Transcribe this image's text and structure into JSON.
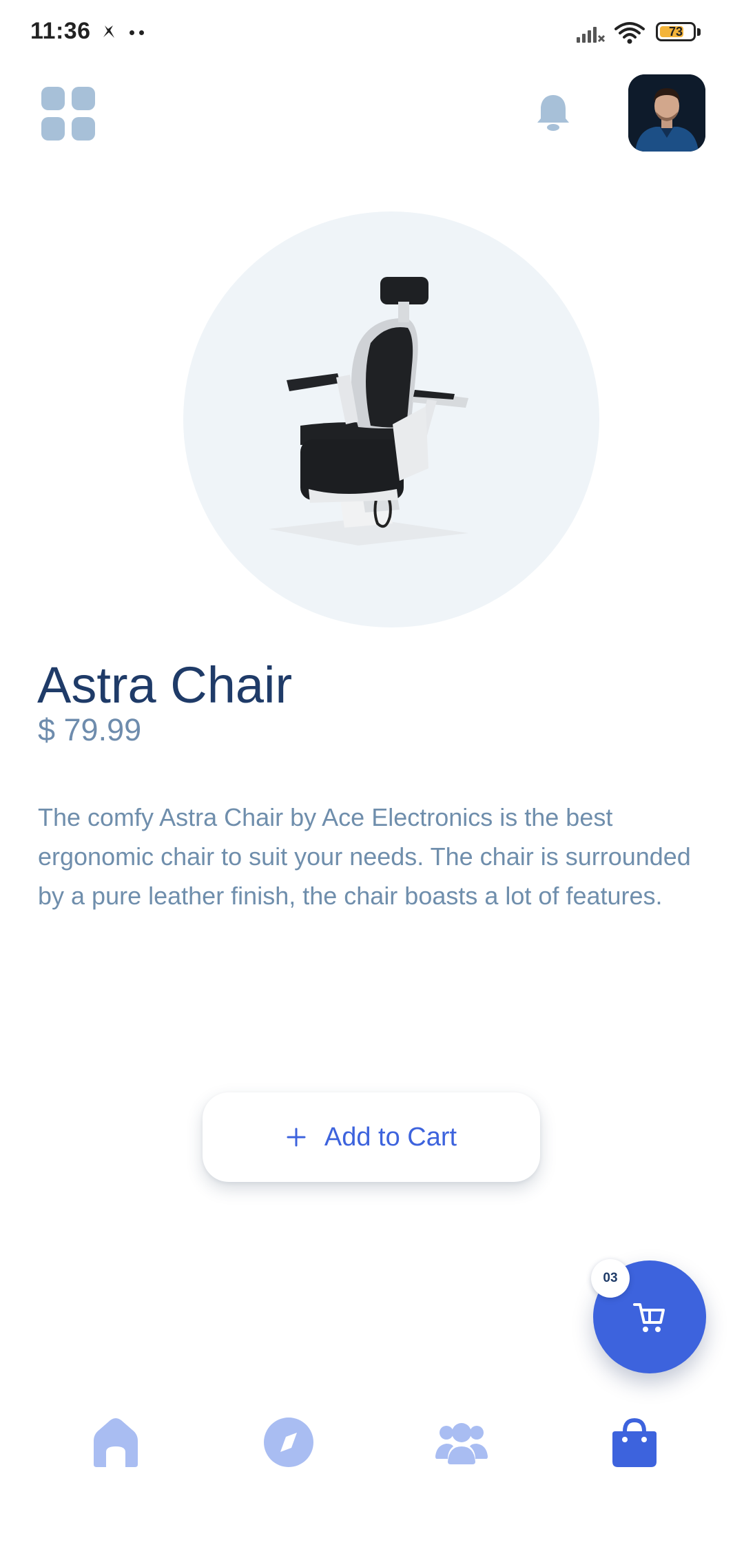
{
  "status_bar": {
    "time": "11:36",
    "battery": "73"
  },
  "header": {
    "menu_icon": "grid-menu-icon",
    "notification_icon": "bell-icon",
    "avatar": "user-avatar"
  },
  "product": {
    "name": "Astra Chair",
    "price": "$ 79.99",
    "description": "The comfy Astra Chair by Ace Electronics is the best ergonomic chair to suit your needs. The chair is surrounded by a pure leather finish, the chair boasts a lot of features.",
    "image": "chair-image"
  },
  "actions": {
    "add_to_cart_label": "Add to Cart",
    "add_icon": "plus-icon"
  },
  "cart": {
    "count": "03",
    "icon": "cart-icon"
  },
  "bottom_nav": {
    "items": [
      {
        "icon": "home-icon",
        "active": false
      },
      {
        "icon": "compass-icon",
        "active": false
      },
      {
        "icon": "users-icon",
        "active": false
      },
      {
        "icon": "shopping-bag-icon",
        "active": true
      }
    ]
  },
  "colors": {
    "accent": "#3d63dd",
    "title": "#1f3b68",
    "muted": "#6f8eac",
    "nav_inactive": "#a9bdf2",
    "image_bg": "#eff4f8"
  }
}
